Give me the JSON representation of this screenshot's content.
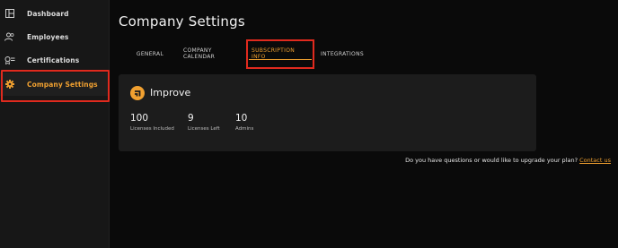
{
  "sidebar": {
    "items": [
      {
        "label": "Dashboard",
        "icon": "dashboard-icon"
      },
      {
        "label": "Employees",
        "icon": "users-icon"
      },
      {
        "label": "Certifications",
        "icon": "certificate-icon"
      },
      {
        "label": "Company Settings",
        "icon": "gear-icon",
        "active": true
      }
    ]
  },
  "main": {
    "title": "Company Settings",
    "tabs": [
      {
        "label": "GENERAL"
      },
      {
        "label": "COMPANY CALENDAR"
      },
      {
        "label": "SUBSCRIPTION INFO",
        "active": true
      },
      {
        "label": "INTEGRATIONS"
      }
    ],
    "plan": {
      "name": "Improve",
      "stats": [
        {
          "value": "100",
          "caption": "Licenses Included"
        },
        {
          "value": "9",
          "caption": "Licenses Left"
        },
        {
          "value": "10",
          "caption": "Admins"
        }
      ]
    },
    "footer": {
      "question": "Do you have questions or would like to upgrade your plan?",
      "link": "Contact us"
    }
  },
  "colors": {
    "accent": "#f0a030",
    "highlight_frame": "#e02a1e",
    "background": "#0a0a0a",
    "sidebar": "#171717",
    "card": "#1c1c1c"
  }
}
